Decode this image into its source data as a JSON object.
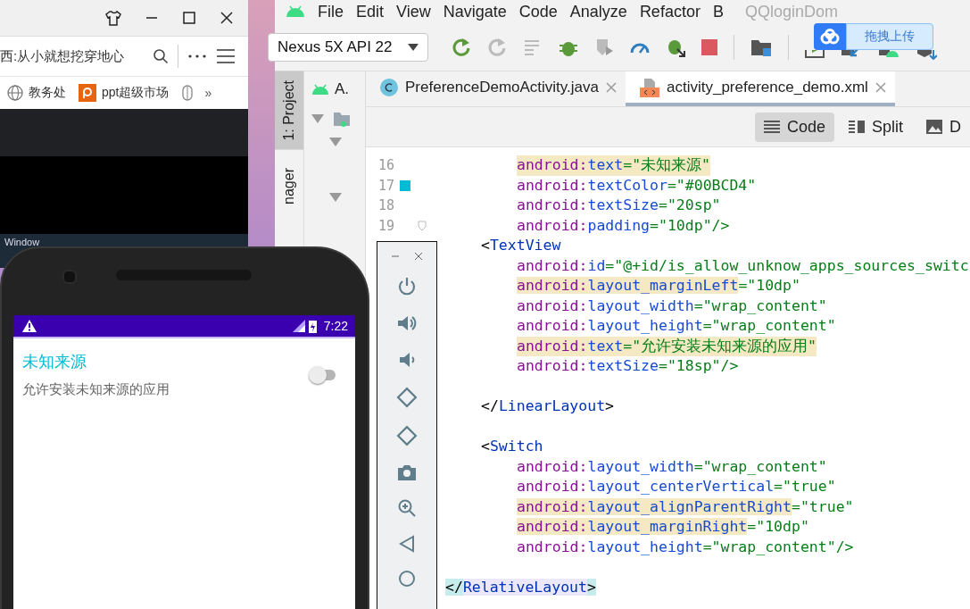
{
  "browser": {
    "address": "西:从小就想挖穿地心",
    "bookmarks": [
      {
        "label": "教务处"
      },
      {
        "label": "ppt超级市场"
      }
    ],
    "more_bookmarks": "»",
    "menu_strip": [
      "Window"
    ]
  },
  "ide": {
    "menu": [
      "File",
      "Edit",
      "View",
      "Navigate",
      "Code",
      "Analyze",
      "Refactor",
      "B"
    ],
    "project_title": "QQloginDom",
    "device": "Nexus 5X API 22",
    "tool_windows": [
      {
        "label": "1: Project",
        "selected": true
      },
      {
        "label": "nager",
        "selected": false
      }
    ],
    "project_tab": "A.",
    "tabs": [
      {
        "label": "PreferenceDemoActivity.java",
        "selected": false
      },
      {
        "label": "activity_preference_demo.xml",
        "selected": true
      }
    ],
    "view_modes": [
      {
        "label": "Code",
        "selected": true
      },
      {
        "label": "Split",
        "selected": false
      },
      {
        "label": "D",
        "selected": false
      }
    ],
    "lines": [
      {
        "number": "16",
        "kind": "attr",
        "ns": "android:",
        "name": "text",
        "value": "=\"未知来源\"",
        "highlighted": true,
        "name_highlighted": false
      },
      {
        "number": "17",
        "kind": "attr",
        "ns": "android:",
        "name": "textColor",
        "value": "=\"#00BCD4\"",
        "highlighted": false,
        "name_highlighted": false,
        "color": "#00bcd4"
      },
      {
        "number": "18",
        "kind": "attr",
        "ns": "android:",
        "name": "textSize",
        "value": "=\"20sp\"",
        "highlighted": false,
        "name_highlighted": false
      },
      {
        "number": "19",
        "kind": "attr",
        "ns": "android:",
        "name": "padding",
        "value": "=\"10dp\"/>",
        "highlighted": false,
        "name_highlighted": false
      },
      {
        "kind": "tag",
        "punct": "<",
        "name": "TextView",
        "matched": false
      },
      {
        "kind": "attr",
        "ns": "android:",
        "name": "id",
        "value": "=\"@+id/is_allow_unknow_apps_sources_switc",
        "highlighted": false,
        "name_highlighted": false
      },
      {
        "kind": "attr",
        "ns": "android:",
        "name": "layout_marginLeft",
        "value": "=\"10dp\"",
        "highlighted": false,
        "name_highlighted": true
      },
      {
        "kind": "attr",
        "ns": "android:",
        "name": "layout_width",
        "value": "=\"wrap_content\"",
        "highlighted": false,
        "name_highlighted": false
      },
      {
        "kind": "attr",
        "ns": "android:",
        "name": "layout_height",
        "value": "=\"wrap_content\"",
        "highlighted": false,
        "name_highlighted": false
      },
      {
        "kind": "attr",
        "ns": "android:",
        "name": "text",
        "value": "=\"允许安装未知来源的应用\"",
        "highlighted": true,
        "name_highlighted": false
      },
      {
        "kind": "attr",
        "ns": "android:",
        "name": "textSize",
        "value": "=\"18sp\"/>",
        "highlighted": false,
        "name_highlighted": false
      },
      {
        "kind": "blank"
      },
      {
        "kind": "tag",
        "punct": "</",
        "name": "LinearLayout",
        "end": ">",
        "matched": false
      },
      {
        "kind": "blank"
      },
      {
        "kind": "tag",
        "punct": "<",
        "name": "Switch",
        "matched": false
      },
      {
        "kind": "attr",
        "ns": "android:",
        "name": "layout_width",
        "value": "=\"wrap_content\"",
        "highlighted": false,
        "name_highlighted": false
      },
      {
        "kind": "attr",
        "ns": "android:",
        "name": "layout_centerVertical",
        "value": "=\"true\"",
        "highlighted": false,
        "name_highlighted": false
      },
      {
        "kind": "attr",
        "ns": "android:",
        "name": "layout_alignParentRight",
        "value": "=\"true\"",
        "highlighted": false,
        "name_highlighted": true
      },
      {
        "kind": "attr",
        "ns": "android:",
        "name": "layout_marginRight",
        "value": "=\"10dp\"",
        "highlighted": false,
        "name_highlighted": true
      },
      {
        "kind": "attr",
        "ns": "android:",
        "name": "layout_height",
        "value": "=\"wrap_content\"/>",
        "highlighted": false,
        "name_highlighted": false
      },
      {
        "kind": "blank"
      },
      {
        "kind": "root",
        "punct": "</",
        "name": "RelativeLayout",
        "end": ">",
        "matched": true
      }
    ]
  },
  "upload_button": {
    "label": "拖拽上传"
  },
  "phone": {
    "time": "7:22",
    "title": "未知来源",
    "summary": "允许安装未知来源的应用",
    "switch": {
      "checked": false
    }
  }
}
